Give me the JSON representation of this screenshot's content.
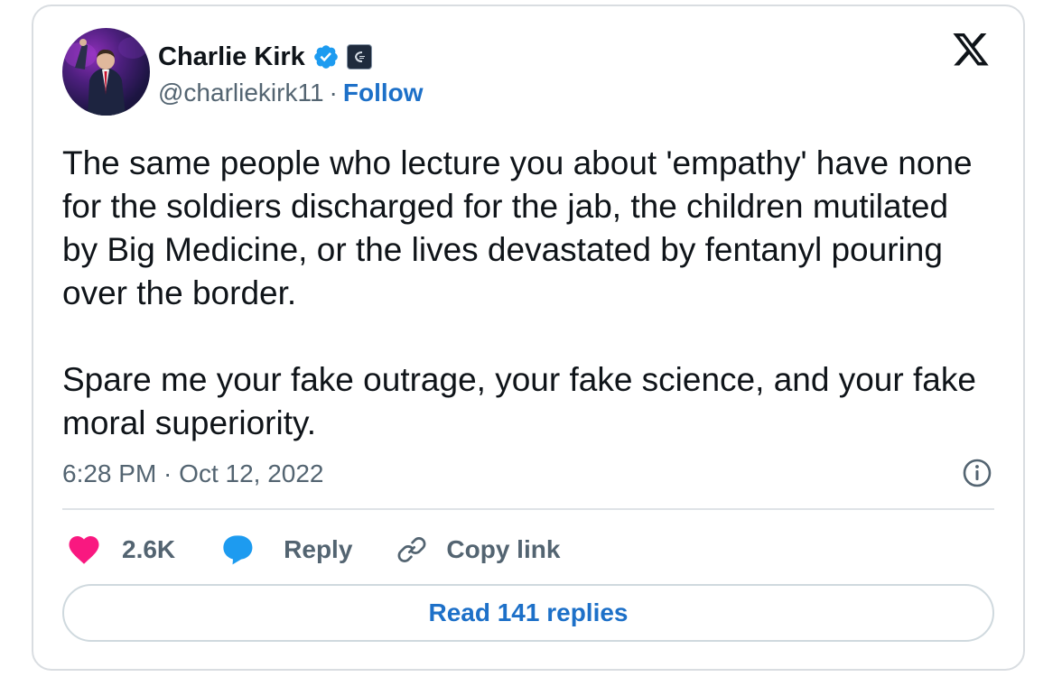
{
  "author": {
    "name": "Charlie Kirk",
    "handle": "@charliekirk11",
    "separator": "·",
    "follow_label": "Follow",
    "verified_badge_color": "#1d9bf0",
    "avatar_icon": "profile-photo"
  },
  "tweet": {
    "paragraphs": [
      "The same people who lecture you about 'empathy' have none for the soldiers discharged for the jab, the children mutilated by Big Medicine, or the lives devastated by fentanyl pouring over the border.",
      "Spare me your fake outrage, your fake science, and your fake moral superiority."
    ],
    "timestamp": "6:28 PM · Oct 12, 2022"
  },
  "actions": {
    "like_count": "2.6K",
    "like_color": "#f91880",
    "reply_label": "Reply",
    "reply_color": "#1d9bf0",
    "copy_link_label": "Copy link"
  },
  "footer": {
    "read_replies_label": "Read 141 replies"
  },
  "theme": {
    "link_color": "#1d70c8",
    "secondary_text": "#536471",
    "border": "#d9dde1"
  }
}
